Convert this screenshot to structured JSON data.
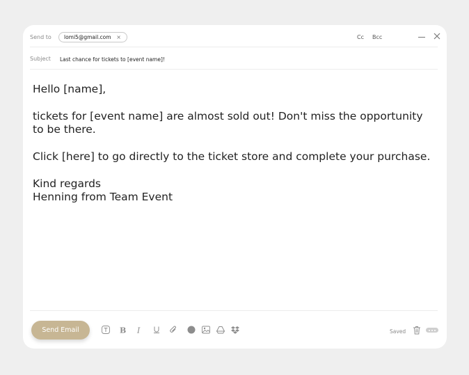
{
  "compose": {
    "to_label": "Send to",
    "recipient_email": "lomi5@gmail.com",
    "recipient_remove": "×",
    "cc_label": "Cc",
    "bcc_label": "Bcc",
    "subject_label": "Subject",
    "subject_value": "Last chance for tickets to [event name]!"
  },
  "body": {
    "greeting": "Hello [name],",
    "paragraph1": "tickets for [event name] are almost sold out! Don't miss the opportunity to be there.",
    "paragraph2": "Click [here] to go directly to the ticket store and complete your purchase.",
    "closing": "Kind regards",
    "signature": "Henning from Team Event"
  },
  "footer": {
    "send_label": "Send Email",
    "saved_label": "Saved",
    "tools": [
      "text-format-icon",
      "bold-icon",
      "italic-icon",
      "underline-icon",
      "attachment-icon",
      "color-icon",
      "image-icon",
      "google-drive-icon",
      "dropbox-icon"
    ]
  },
  "colors": {
    "accent": "#c7b694",
    "background": "#efefef",
    "card": "#ffffff"
  }
}
